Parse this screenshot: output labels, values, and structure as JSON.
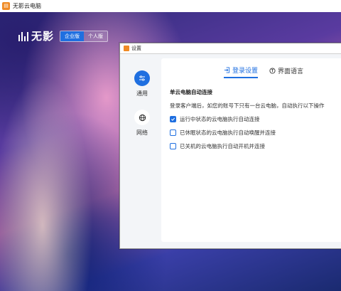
{
  "window": {
    "title": "无影云电脑",
    "icon": "app-logo-icon"
  },
  "brand": {
    "logo_text": "无影",
    "editions": [
      {
        "label": "企业版",
        "active": true
      },
      {
        "label": "个人版",
        "active": false
      }
    ]
  },
  "dialog": {
    "title": "设置",
    "sidebar": [
      {
        "label": "通用",
        "icon": "sliders-icon",
        "active": true
      },
      {
        "label": "网络",
        "icon": "globe-icon",
        "active": false
      }
    ],
    "tabs": [
      {
        "label": "登录设置",
        "icon": "login-icon",
        "active": true
      },
      {
        "label": "界面语言",
        "icon": "language-icon",
        "active": false
      }
    ],
    "section_title": "单云电脑自动连接",
    "description": "登录客户端后，如您的账号下只有一台云电脑，自动执行以下操作",
    "options": [
      {
        "label": "运行中状态的云电脑执行自动连接",
        "checked": true
      },
      {
        "label": "已休眠状态的云电脑执行自动唤醒并连接",
        "checked": false
      },
      {
        "label": "已关机的云电脑执行自动开机并连接",
        "checked": false
      }
    ]
  },
  "colors": {
    "accent": "#1f6fe0",
    "brand_orange": "#f08a24"
  }
}
